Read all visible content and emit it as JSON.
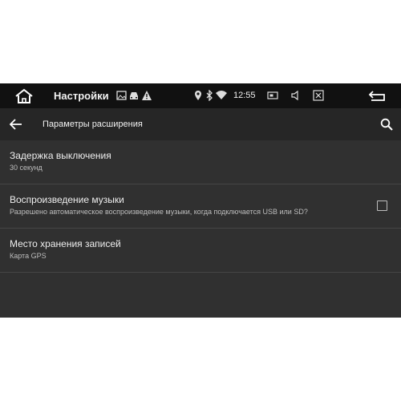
{
  "statusbar": {
    "title": "Настройки",
    "time": "12:55",
    "icons": [
      "home-icon",
      "image-icon",
      "car-icon",
      "warning-icon",
      "location-icon",
      "bluetooth-icon",
      "wifi-icon",
      "screen-icon",
      "volume-icon",
      "close-window-icon",
      "back-icon"
    ]
  },
  "appbar": {
    "title": "Параметры расширения",
    "back_icon": "arrow-left-icon",
    "search_icon": "search-icon"
  },
  "settings": [
    {
      "title": "Задержка выключения",
      "subtitle": "30 секунд",
      "has_checkbox": false
    },
    {
      "title": "Воспроизведение музыки",
      "subtitle": "Разрешено автоматическое воспроизведение музыки, когда подключается USB или SD?",
      "has_checkbox": true,
      "checked": false
    },
    {
      "title": "Место хранения записей",
      "subtitle": "Карта GPS",
      "has_checkbox": false
    }
  ],
  "colors": {
    "background": "#303030",
    "statusbar": "#111111",
    "appbar": "#262626",
    "divider": "#454545"
  }
}
